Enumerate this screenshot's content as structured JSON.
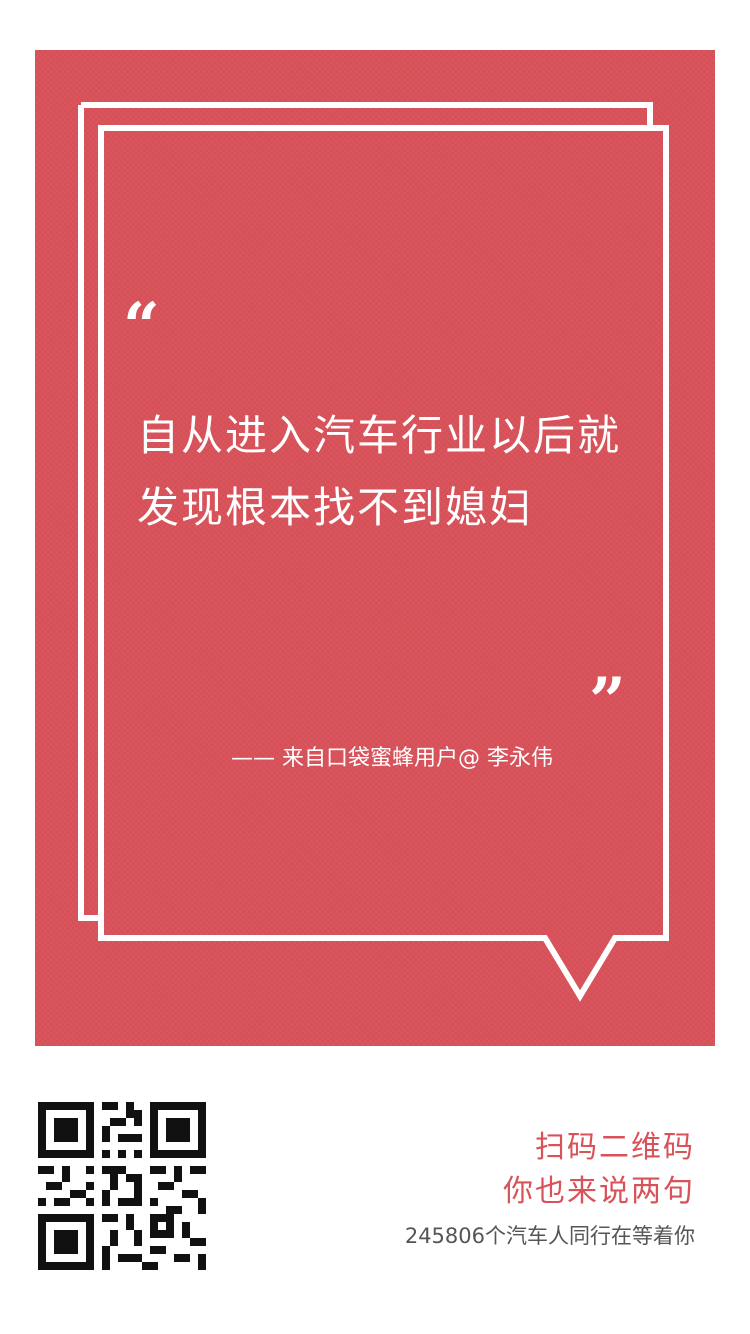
{
  "colors": {
    "brand_red": "#d9525a",
    "frame_white": "#ffffff",
    "sub_text": "#555555"
  },
  "quote": {
    "open_mark": "“",
    "close_mark": "”",
    "lines": [
      "自从进入汽车行业以后就",
      "发现根本找不到媳妇"
    ],
    "attribution": "—— 来自口袋蜜蜂用户@ 李永伟"
  },
  "footer": {
    "qr_icon": "qr-code-icon",
    "cta_line1": "扫码二维码",
    "cta_line2": "你也来说两句",
    "cta_sub": "245806个汽车人同行在等着你"
  }
}
